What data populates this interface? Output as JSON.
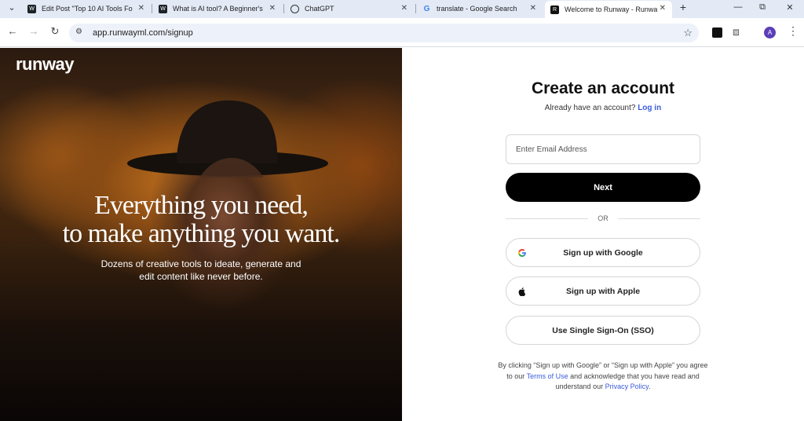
{
  "browser": {
    "tabs": [
      {
        "title": "Edit Post \"Top 10 AI Tools Fo",
        "active": false
      },
      {
        "title": "What is AI tool? A Beginner's",
        "active": false
      },
      {
        "title": "ChatGPT",
        "active": false
      },
      {
        "title": "translate - Google Search",
        "active": false
      },
      {
        "title": "Welcome to Runway - Runwa",
        "active": true
      }
    ],
    "url": "app.runwayml.com/signup",
    "profile_initial": "A"
  },
  "hero": {
    "logo": "runway",
    "headline_line1": "Everything you need,",
    "headline_line2": "to make anything you want.",
    "subtext_line1": "Dozens of creative tools to ideate, generate and",
    "subtext_line2": "edit content like never before."
  },
  "signup": {
    "title": "Create an account",
    "already_text": "Already have an account?",
    "login_link": "Log in",
    "email_placeholder": "Enter Email Address",
    "next_button": "Next",
    "or_text": "OR",
    "google_button": "Sign up with Google",
    "apple_button": "Sign up with Apple",
    "sso_button": "Use Single Sign-On (SSO)",
    "legal_part1": "By clicking “Sign up with Google” or “Sign up with Apple” you agree to our",
    "terms_link": "Terms of Use",
    "legal_part2": "and acknowledge that you have read and understand our",
    "privacy_link": "Privacy Policy",
    "legal_end": "."
  },
  "colors": {
    "accent_link": "#3b5bdb",
    "primary_button": "#000000",
    "tabbar_bg": "#e3e9f5"
  }
}
